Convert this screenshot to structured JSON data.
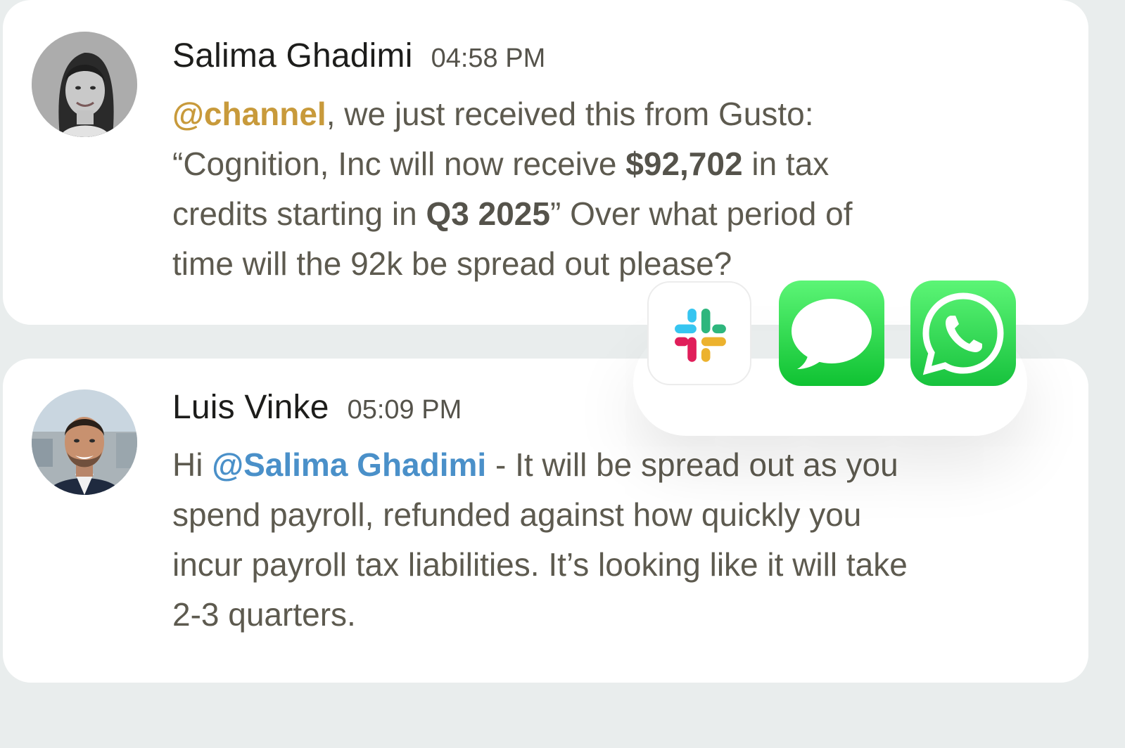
{
  "messages": [
    {
      "author": "Salima Ghadimi",
      "time": "04:58 PM",
      "lines": [
        {
          "mention": "@channel",
          "text": ", we just received this from Gusto:"
        },
        {
          "pre": "“Cognition, Inc will now receive ",
          "strong": "$92,702",
          "post": " in tax"
        },
        {
          "pre": "credits starting in ",
          "strong": "Q3 2025",
          "post": "” Over what period of"
        },
        {
          "text": "time will the 92k be spread out please?"
        }
      ]
    },
    {
      "author": "Luis Vinke",
      "time": "05:09 PM",
      "lines": [
        {
          "pre": "Hi ",
          "mention": "@Salima Ghadimi",
          "post": " - It will be spread out as you"
        },
        {
          "text": "spend payroll, refunded against how quickly you"
        },
        {
          "text": "incur payroll tax liabilities. It’s looking like it will take"
        },
        {
          "text": "2-3 quarters."
        }
      ]
    }
  ],
  "apps": [
    {
      "icon": "slack-icon"
    },
    {
      "icon": "imessage-icon"
    },
    {
      "icon": "whatsapp-icon"
    }
  ],
  "colors": {
    "background": "#e9eded",
    "card": "#ffffff",
    "channel_mention": "#c89a3b",
    "user_mention": "#4a90c9",
    "body_text": "#5d5a4f"
  }
}
